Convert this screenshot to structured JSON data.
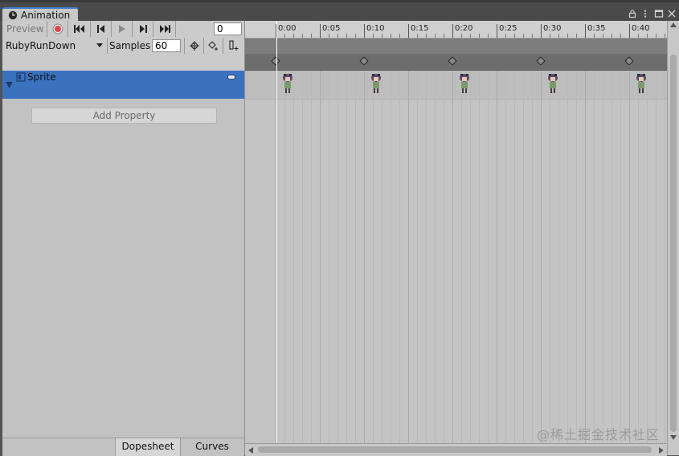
{
  "tab": {
    "title": "Animation"
  },
  "toolbar": {
    "preview_label": "Preview",
    "frame_value": "0",
    "clip_name": "RubyRunDown",
    "samples_label": "Samples",
    "samples_value": "60"
  },
  "properties": [
    {
      "label": "Sprite"
    }
  ],
  "add_property_label": "Add Property",
  "bottom_tabs": {
    "dopesheet": "Dopesheet",
    "curves": "Curves"
  },
  "timeline": {
    "ticks": [
      "0:00",
      "0:05",
      "0:10",
      "0:15",
      "0:20",
      "0:25",
      "0:30",
      "0:35",
      "0:40"
    ],
    "keyframe_times": [
      "0:00",
      "0:10",
      "0:20",
      "0:30",
      "0:40"
    ]
  },
  "watermark": "@稀土掘金技术社区",
  "colors": {
    "accent": "#3a72c0",
    "record": "#e0454f",
    "tab_highlight": "#3d7fd1"
  }
}
